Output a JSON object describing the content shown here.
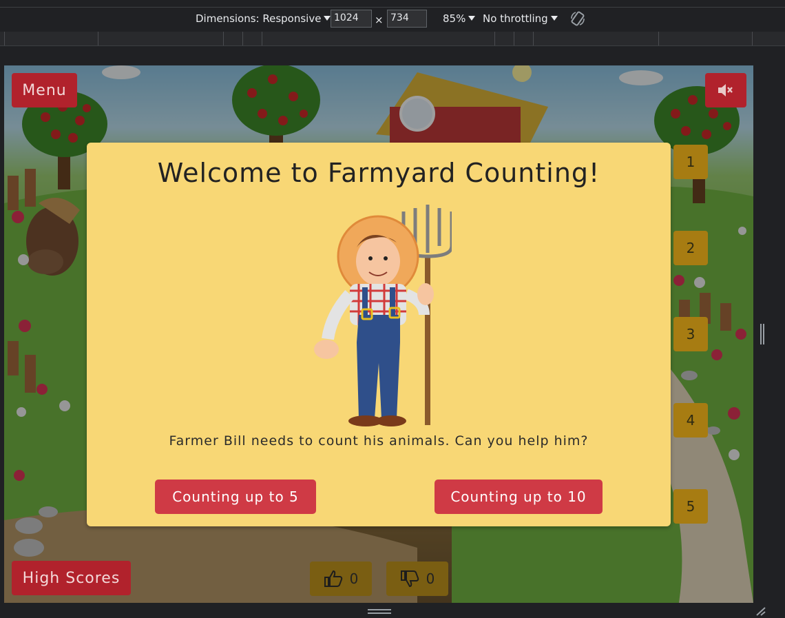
{
  "devtools": {
    "dimensions_label": "Dimensions: Responsive",
    "width_value": "1024",
    "times_sign": "×",
    "height_value": "734",
    "zoom_label": "85%",
    "throttling_label": "No throttling",
    "rotate_icon": "rotate-icon"
  },
  "game": {
    "menu_label": "Menu",
    "mute_icon": "mute-icon",
    "number_tiles": [
      "1",
      "2",
      "3",
      "4",
      "5"
    ],
    "high_scores_label": "High Scores",
    "thumbs_up_count": "0",
    "thumbs_down_count": "0"
  },
  "modal": {
    "title": "Welcome to Farmyard Counting!",
    "text": "Farmer Bill needs to count his animals. Can you help him?",
    "button_5": "Counting up to 5",
    "button_10": "Counting up to 10"
  },
  "colors": {
    "modal_bg": "#f8d775",
    "button_red": "#cf3a45",
    "menu_red": "#b1222c",
    "tile_gold": "#a77c12"
  }
}
